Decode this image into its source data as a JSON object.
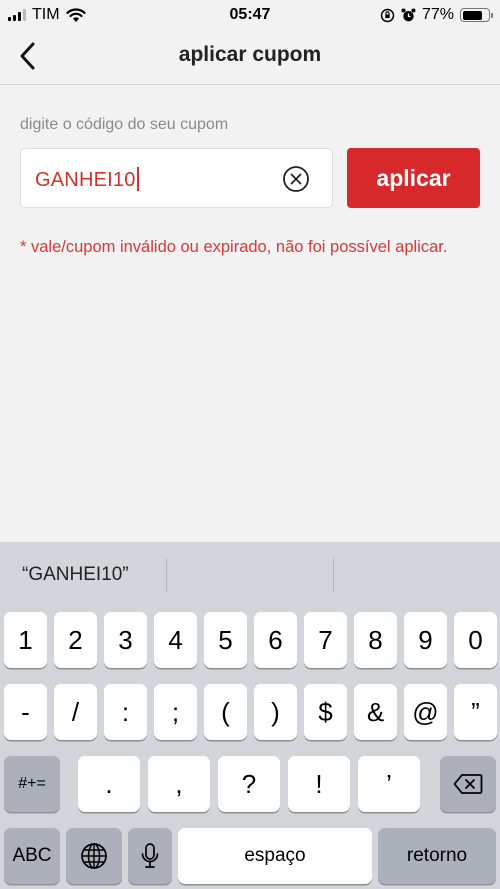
{
  "status": {
    "carrier": "TIM",
    "time": "05:47",
    "battery": "77%",
    "battery_level": 0.77
  },
  "nav": {
    "title": "aplicar cupom"
  },
  "coupon": {
    "label": "digite o código do seu cupom",
    "value": "GANHEI10",
    "apply_label": "aplicar",
    "error": "* vale/cupom inválido ou expirado, não foi possível aplicar."
  },
  "keyboard": {
    "suggestion": "“GANHEI10”",
    "row1": [
      "1",
      "2",
      "3",
      "4",
      "5",
      "6",
      "7",
      "8",
      "9",
      "0"
    ],
    "row2": [
      "-",
      "/",
      ":",
      ";",
      "(",
      ")",
      "$",
      "&",
      "@",
      "”"
    ],
    "row3": [
      ".",
      ",",
      "?",
      "!",
      "’"
    ],
    "mode_switch": "#+=",
    "abc": "ABC",
    "space": "espaço",
    "return": "retorno"
  }
}
